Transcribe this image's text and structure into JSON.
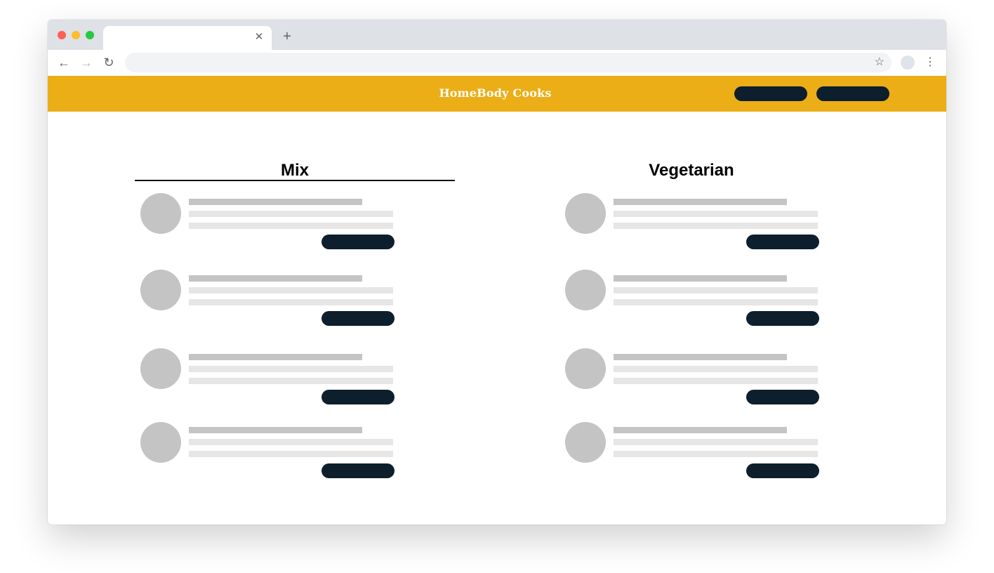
{
  "browser": {
    "tab_title": "",
    "tab_close_glyph": "✕",
    "new_tab_glyph": "+",
    "back_glyph": "←",
    "forward_glyph": "→",
    "reload_glyph": "↻",
    "address_value": "",
    "bookmark_glyph": "☆",
    "menu_glyph": "⋮",
    "traffic_lights": [
      "#ff5f57",
      "#febc2e",
      "#28c840"
    ]
  },
  "site": {
    "title": "HomeBody Cooks",
    "header_color": "#ecae16",
    "button_color": "#0d1f2d",
    "header_buttons": [
      "",
      ""
    ]
  },
  "columns": [
    {
      "title": "Mix",
      "selected": true,
      "items": [
        {
          "title": "",
          "line1": "",
          "line2": "",
          "button_label": ""
        },
        {
          "title": "",
          "line1": "",
          "line2": "",
          "button_label": ""
        },
        {
          "title": "",
          "line1": "",
          "line2": "",
          "button_label": ""
        },
        {
          "title": "",
          "line1": "",
          "line2": "",
          "button_label": ""
        }
      ]
    },
    {
      "title": "Vegetarian",
      "selected": false,
      "items": [
        {
          "title": "",
          "line1": "",
          "line2": "",
          "button_label": ""
        },
        {
          "title": "",
          "line1": "",
          "line2": "",
          "button_label": ""
        },
        {
          "title": "",
          "line1": "",
          "line2": "",
          "button_label": ""
        },
        {
          "title": "",
          "line1": "",
          "line2": "",
          "button_label": ""
        }
      ]
    }
  ],
  "colors": {
    "placeholder_title": "#c4c4c4",
    "placeholder_line": "#e6e6e6",
    "avatar": "#c4c4c4",
    "underline": "#000000"
  }
}
